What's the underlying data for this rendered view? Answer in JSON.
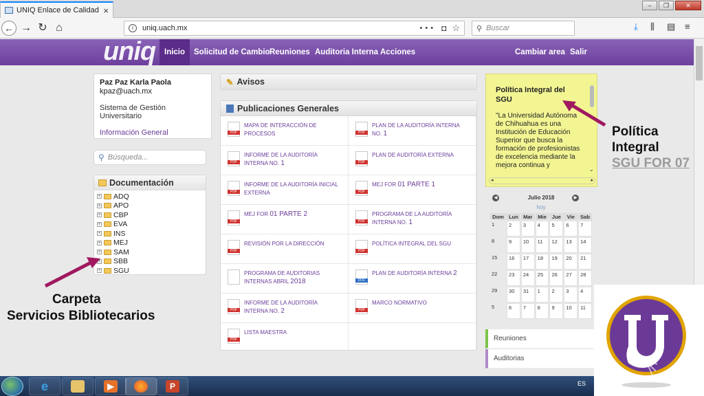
{
  "browser": {
    "tab_title": "UNIQ Enlace de Calidad | UACH",
    "url": "uniq.uach.mx",
    "url_actions": "•••",
    "search_placeholder": "Buscar"
  },
  "app": {
    "logo": "uniq",
    "menu": [
      "Inicio",
      "Solicitud de Cambio",
      "Reuniones",
      "Auditoria Interna",
      "Acciones"
    ],
    "menu_right": [
      "Cambiar area",
      "Salir"
    ]
  },
  "user": {
    "name": "Paz Paz Karla Paola",
    "email": "kpaz@uach.mx",
    "system": "Sistema de Gestión Universitario",
    "info_link": "Información General"
  },
  "quick_search": {
    "placeholder": "Búsqueda..."
  },
  "documentacion": {
    "title": "Documentación",
    "folders": [
      "ADQ",
      "APO",
      "CBP",
      "EVA",
      "INS",
      "MEJ",
      "SAM",
      "SBB",
      "SGU"
    ]
  },
  "avisos": {
    "title": "Avisos"
  },
  "publicaciones": {
    "title": "Publicaciones Generales",
    "items": [
      {
        "label": "MAPA DE INTERACCIÓN DE PROCESOS",
        "suffix": "",
        "icon": "pdf"
      },
      {
        "label": "PLAN DE LA AUDITORÍA INTERNA NO.",
        "suffix": "1",
        "icon": "pdf"
      },
      {
        "label": "INFORME DE LA AUDITORÍA INTERNA NO.",
        "suffix": "1",
        "icon": "pdf"
      },
      {
        "label": "PLAN DE AUDITORÍA EXTERNA",
        "suffix": "",
        "icon": "pdf"
      },
      {
        "label": "INFORME DE LA AUDITORÍA INICIAL EXTERNA",
        "suffix": "",
        "icon": "pdf"
      },
      {
        "label": "MEJ FOR",
        "suffix": "01 PARTE 1",
        "icon": "pdf"
      },
      {
        "label": "MEJ FOR",
        "suffix": "01 PARTE 2",
        "icon": "pdf"
      },
      {
        "label": "PROGRAMA DE LA AUDITORÍA INTERNA NO.",
        "suffix": "1",
        "icon": "pdf"
      },
      {
        "label": "REVISIÓN POR LA DIRECCIÓN",
        "suffix": "",
        "icon": "pdf"
      },
      {
        "label": "POLÍTICA INTEGRAL DEL SGU",
        "suffix": "",
        "icon": "pdf"
      },
      {
        "label": "PROGRAMA DE AUDITORIAS INTERNAS ABRIL",
        "suffix": "2018",
        "icon": "blank"
      },
      {
        "label": "PLAN DE AUDITORÍA INTERNA",
        "suffix": "2",
        "icon": "doc"
      },
      {
        "label": "INFORME DE LA AUDITORÍA INTERNA NO.",
        "suffix": "2",
        "icon": "pdf"
      },
      {
        "label": "MARCO NORMATIVO",
        "suffix": "",
        "icon": "pdf"
      },
      {
        "label": "LISTA MAESTRA",
        "suffix": "",
        "icon": "pdf"
      },
      {
        "label": "",
        "suffix": "",
        "icon": "none"
      }
    ]
  },
  "politica": {
    "title": "Política Integral del SGU",
    "body": "\"La Universidad Autónoma de Chihuahua es una Institución de Educación Superior que busca la formación de profesionistas de excelencia mediante la mejora continua y"
  },
  "calendar": {
    "month": "Julio 2018",
    "today": "hoy",
    "days": [
      "Dom",
      "Lun",
      "Mar",
      "Mie",
      "Jue",
      "Vie",
      "Sab"
    ],
    "weeks": [
      [
        "1",
        "2",
        "3",
        "4",
        "5",
        "6",
        "7"
      ],
      [
        "8",
        "9",
        "10",
        "11",
        "12",
        "13",
        "14"
      ],
      [
        "15",
        "16",
        "17",
        "18",
        "19",
        "20",
        "21"
      ],
      [
        "22",
        "23",
        "24",
        "25",
        "26",
        "27",
        "28"
      ],
      [
        "29",
        "30",
        "31",
        "1",
        "2",
        "3",
        "4"
      ],
      [
        "5",
        "6",
        "7",
        "8",
        "9",
        "10",
        "11"
      ]
    ]
  },
  "side_menu": [
    {
      "label": "Reuniones",
      "color": "#7cc44a"
    },
    {
      "label": "Auditorias",
      "color": "#b08ac9"
    }
  ],
  "annotations": {
    "politica_line1": "Política",
    "politica_line2": "Integral",
    "politica_line3": "SGU FOR 07",
    "carpeta_line1": "Carpeta",
    "carpeta_line2": "Servicios Bibliotecarios"
  },
  "taskbar": {
    "lang": "ES"
  },
  "colors": {
    "brand": "#6c3f9c",
    "accent": "#5b2c8a",
    "note": "#f3f593",
    "arrow": "#a0195f"
  }
}
